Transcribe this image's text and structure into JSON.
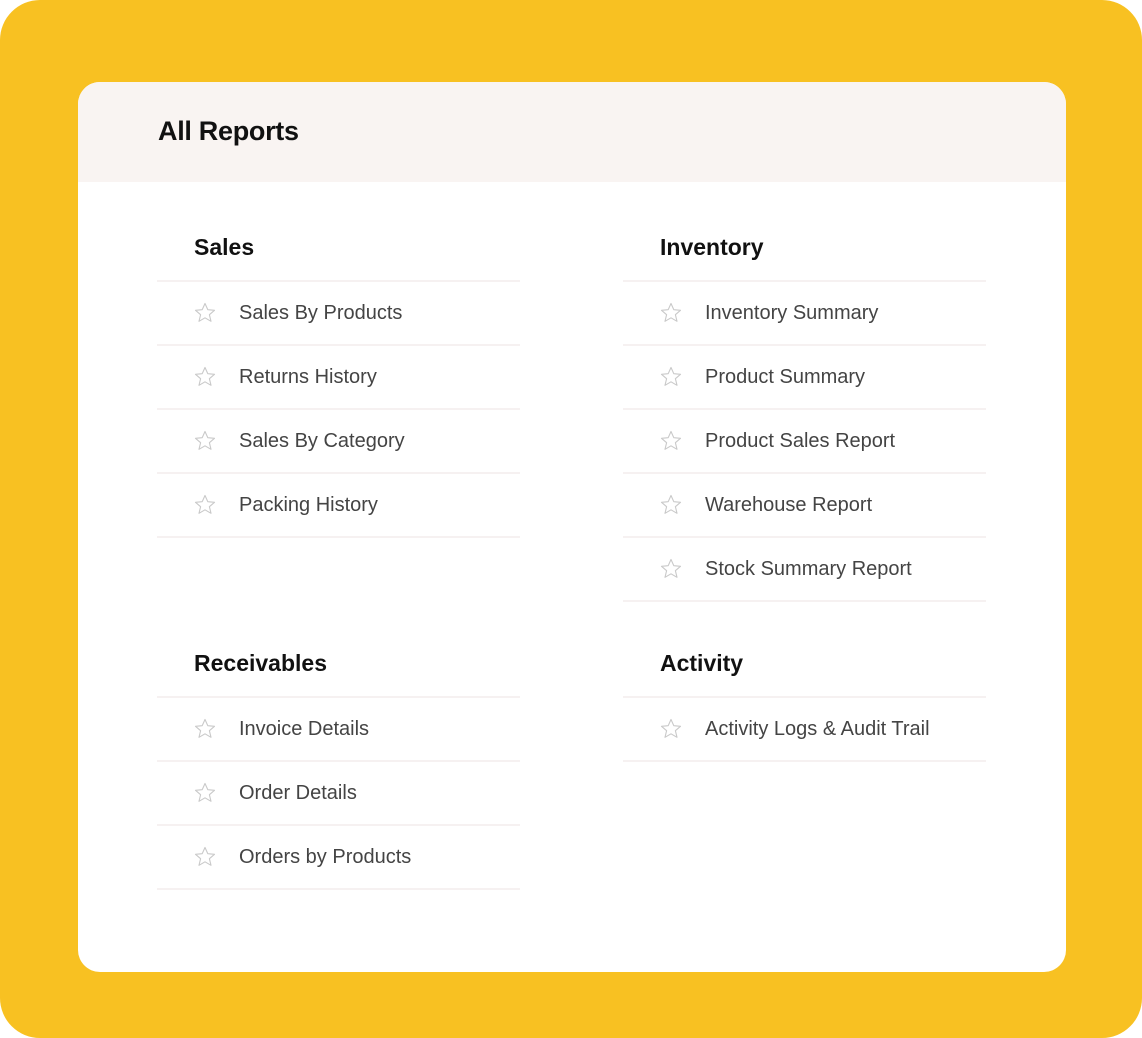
{
  "page": {
    "title": "All Reports",
    "colors": {
      "frame": "#f8c122",
      "header": "#f9f4f2",
      "divider": "#f6f1f1"
    }
  },
  "sections": {
    "sales": {
      "title": "Sales",
      "items": [
        {
          "label": "Sales By Products",
          "icon": "star-outline-icon"
        },
        {
          "label": "Returns History",
          "icon": "star-outline-icon"
        },
        {
          "label": "Sales By Category",
          "icon": "star-outline-icon"
        },
        {
          "label": "Packing History",
          "icon": "star-outline-icon"
        }
      ]
    },
    "inventory": {
      "title": "Inventory",
      "items": [
        {
          "label": "Inventory Summary",
          "icon": "star-outline-icon"
        },
        {
          "label": "Product Summary",
          "icon": "star-outline-icon"
        },
        {
          "label": "Product Sales Report",
          "icon": "star-outline-icon"
        },
        {
          "label": "Warehouse Report",
          "icon": "star-outline-icon"
        },
        {
          "label": "Stock Summary Report",
          "icon": "star-outline-icon"
        }
      ]
    },
    "receivables": {
      "title": "Receivables",
      "items": [
        {
          "label": "Invoice Details",
          "icon": "star-outline-icon"
        },
        {
          "label": "Order Details",
          "icon": "star-outline-icon"
        },
        {
          "label": "Orders by Products",
          "icon": "star-outline-icon"
        }
      ]
    },
    "activity": {
      "title": "Activity",
      "items": [
        {
          "label": "Activity Logs & Audit Trail",
          "icon": "star-outline-icon"
        }
      ]
    }
  }
}
